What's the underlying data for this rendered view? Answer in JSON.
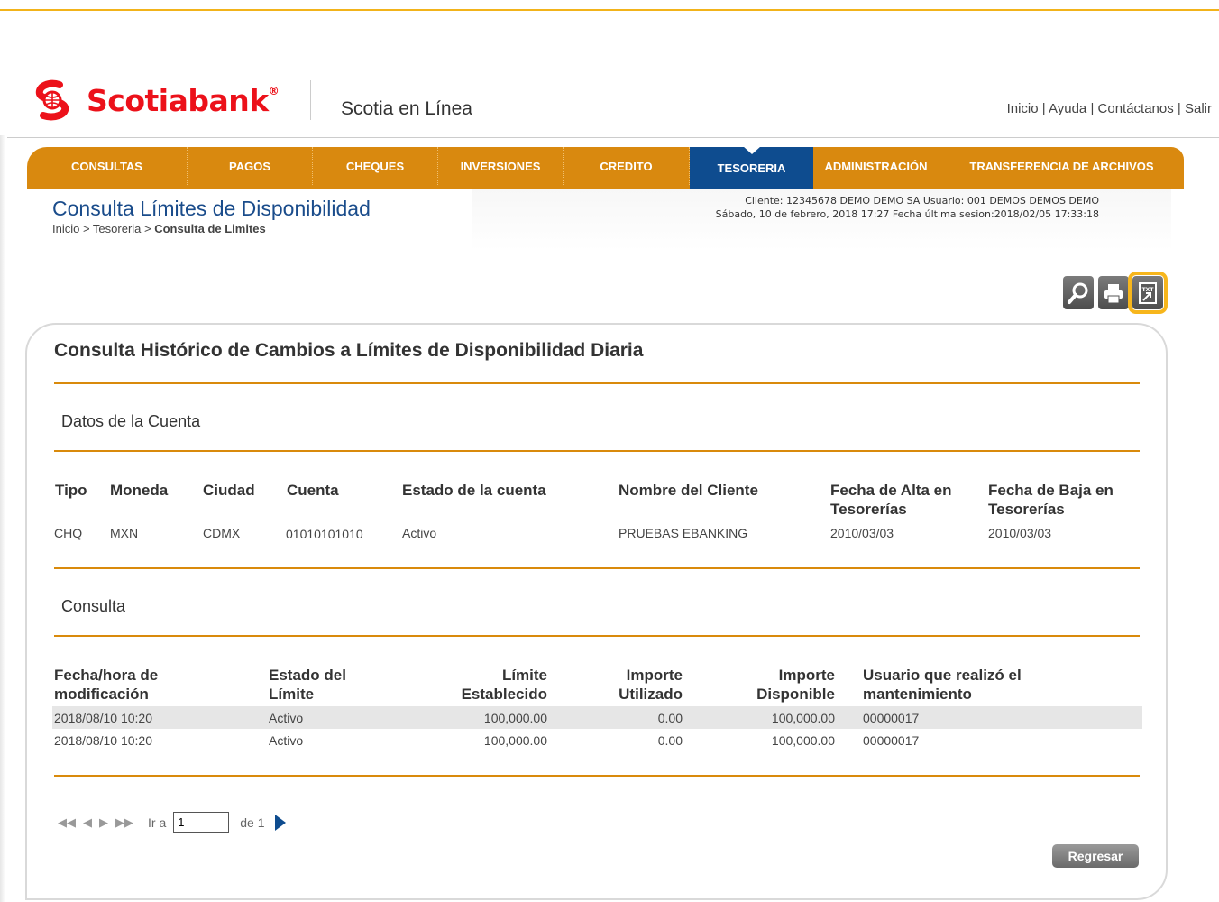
{
  "header": {
    "brand": "Scotiabank",
    "brand_mark": "®",
    "app_title": "Scotia en Línea",
    "links": [
      "Inicio",
      "Ayuda",
      "Contáctanos",
      "Salir"
    ],
    "link_separator": " | "
  },
  "nav": {
    "items": [
      {
        "label": "CONSULTAS",
        "width": 178
      },
      {
        "label": "PAGOS",
        "width": 139
      },
      {
        "label": "CHEQUES",
        "width": 139
      },
      {
        "label": "INVERSIONES",
        "width": 139
      },
      {
        "label": "CREDITO",
        "width": 140
      },
      {
        "label": "TESORERIA",
        "width": 137,
        "active": true
      },
      {
        "label": "ADMINISTRACIÓN",
        "width": 140
      },
      {
        "label": "TRANSFERENCIA DE ARCHIVOS",
        "width": 271
      }
    ]
  },
  "page": {
    "title": "Consulta Límites de Disponibilidad",
    "breadcrumb_prefix": "Inicio > Tesoreria > ",
    "breadcrumb_current": "Consulta de Limites"
  },
  "session": {
    "line1": "Cliente: 12345678 DEMO DEMO SA     Usuario: 001 DEMOS DEMOS DEMO",
    "line2": "Sábado, 10 de febrero, 2018 17:27     Fecha última sesion:2018/02/05 17:33:18"
  },
  "tools": [
    {
      "name": "search-icon"
    },
    {
      "name": "print-icon"
    },
    {
      "name": "txt-export-icon",
      "label": "TXT"
    }
  ],
  "panel": {
    "title": "Consulta Histórico de Cambios a Límites de Disponibilidad Diaria",
    "account_section": "Datos de la Cuenta",
    "query_section": "Consulta"
  },
  "account": {
    "headers": [
      "Tipo",
      "Moneda",
      "Ciudad",
      "Cuenta",
      "Estado de la cuenta",
      "Nombre del Cliente",
      "Fecha de Alta en Tesorerías",
      "Fecha de Baja en Tesorerías"
    ],
    "row": [
      "CHQ",
      "MXN",
      "CDMX",
      "01010101010",
      "Activo",
      "PRUEBAS EBANKING",
      "2010/03/03",
      "2010/03/03"
    ]
  },
  "limits": {
    "headers": [
      "Fecha/hora de modificación",
      "Estado del Límite",
      "Límite Establecido",
      "Importe Utilizado",
      "Importe Disponible",
      "Usuario que realizó el mantenimiento"
    ],
    "rows": [
      [
        "2018/08/10 10:20",
        "Activo",
        "100,000.00",
        "0.00",
        "100,000.00",
        "00000017"
      ],
      [
        "2018/08/10 10:20",
        "Activo",
        "100,000.00",
        "0.00",
        "100,000.00",
        "00000017"
      ]
    ]
  },
  "pager": {
    "go_to_label": "Ir a",
    "page_value": "1",
    "of_label": "de 1"
  },
  "actions": {
    "back_label": "Regresar"
  },
  "colors": {
    "brand_red": "#ec111a",
    "nav_orange": "#d9890f",
    "nav_active": "#0e4c8f",
    "rule_orange": "#d98a0c",
    "highlight": "#f7b61c"
  }
}
